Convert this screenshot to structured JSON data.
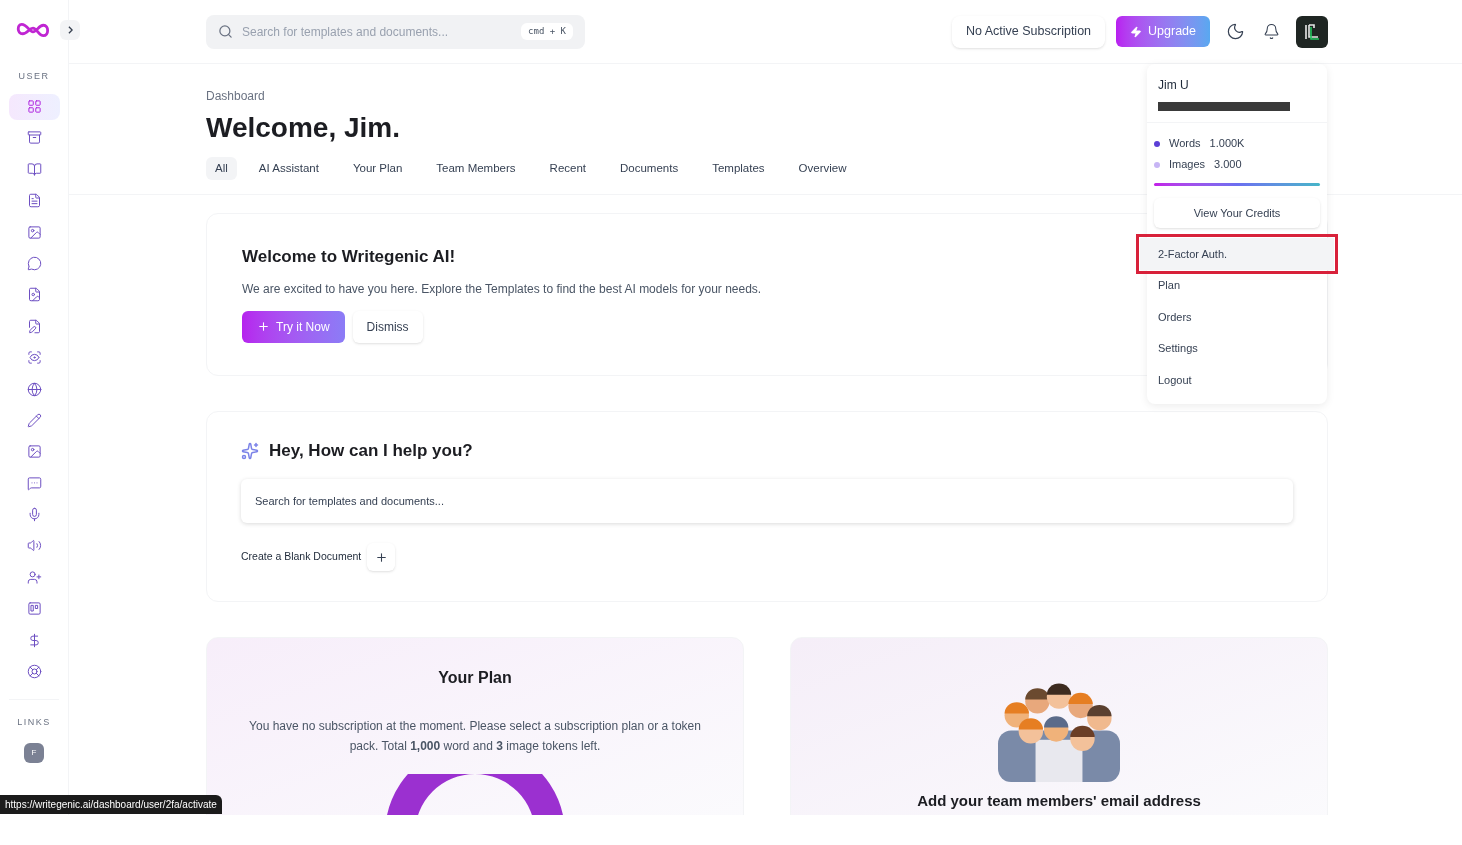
{
  "sidebar": {
    "section_label": "USER",
    "items": [
      {
        "selected": true
      },
      {
        "selected": false
      },
      {
        "selected": false
      },
      {
        "selected": false
      },
      {
        "selected": false
      },
      {
        "selected": false
      },
      {
        "selected": false
      },
      {
        "selected": false
      },
      {
        "selected": false
      },
      {
        "selected": false
      },
      {
        "selected": false
      },
      {
        "selected": false
      },
      {
        "selected": false
      },
      {
        "selected": false
      },
      {
        "selected": false
      },
      {
        "selected": false
      },
      {
        "selected": false
      },
      {
        "selected": false
      },
      {
        "selected": false
      }
    ],
    "links_label": "LINKS",
    "link_badge": "F"
  },
  "header": {
    "search": {
      "placeholder": "Search for templates and documents...",
      "shortcut": "cmd + K"
    },
    "subscription": "No Active Subscription",
    "upgrade": "Upgrade"
  },
  "breadcrumb": "Dashboard",
  "title": "Welcome, Jim.",
  "tabs": [
    {
      "label": "All",
      "selected": true
    },
    {
      "label": "AI Assistant",
      "selected": false
    },
    {
      "label": "Your Plan",
      "selected": false
    },
    {
      "label": "Team Members",
      "selected": false
    },
    {
      "label": "Recent",
      "selected": false
    },
    {
      "label": "Documents",
      "selected": false
    },
    {
      "label": "Templates",
      "selected": false
    },
    {
      "label": "Overview",
      "selected": false
    }
  ],
  "welcome_card": {
    "title": "Welcome to Writegenic AI!",
    "text": "We are excited to have you here. Explore the Templates to find the best AI models for your needs.",
    "primary": "Try it Now",
    "secondary": "Dismiss"
  },
  "assistant_card": {
    "title": "Hey, How can I help you?",
    "placeholder": "Search for templates and documents...",
    "create": "Create a Blank Document"
  },
  "plan_card": {
    "title": "Your Plan",
    "text": "You have no subscription at the moment. Please select a subscription plan or a token pack. Total **1,000** word and **3** image tokens left."
  },
  "team_card": {
    "title": "Add your team members' email address"
  },
  "user_menu": {
    "name": "Jim U",
    "credits": [
      {
        "label": "Words",
        "value": "1.000K",
        "color": "#5b3fd6"
      },
      {
        "label": "Images",
        "value": "3.000",
        "color": "#c7b5f5"
      }
    ],
    "view_credits": "View Your Credits",
    "items": [
      {
        "label": "2-Factor Auth.",
        "highlighted": true
      },
      {
        "label": "Plan",
        "highlighted": false
      },
      {
        "label": "Orders",
        "highlighted": false
      },
      {
        "label": "Settings",
        "highlighted": false
      },
      {
        "label": "Logout",
        "highlighted": false
      }
    ]
  },
  "status_url": "https://writegenic.ai/dashboard/user/2fa/activate"
}
